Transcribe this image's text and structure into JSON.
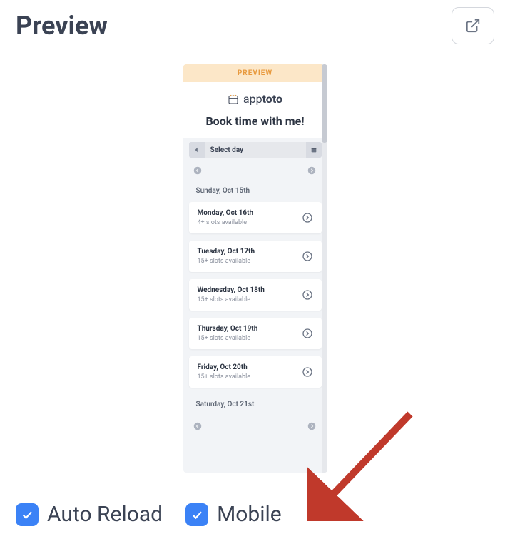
{
  "header": {
    "title": "Preview"
  },
  "mobile": {
    "banner": "PREVIEW",
    "brand_light": "app",
    "brand_bold": "toto",
    "book_title": "Book time with me!",
    "select_label": "Select day",
    "sunday_label": "Sunday, Oct 15th",
    "saturday_label": "Saturday, Oct 21st",
    "days": [
      {
        "title": "Monday, Oct 16th",
        "sub": "4+ slots available"
      },
      {
        "title": "Tuesday, Oct 17th",
        "sub": "15+ slots available"
      },
      {
        "title": "Wednesday, Oct 18th",
        "sub": "15+ slots available"
      },
      {
        "title": "Thursday, Oct 19th",
        "sub": "15+ slots available"
      },
      {
        "title": "Friday, Oct 20th",
        "sub": "15+ slots available"
      }
    ]
  },
  "footer": {
    "auto_reload": "Auto Reload",
    "mobile": "Mobile"
  }
}
